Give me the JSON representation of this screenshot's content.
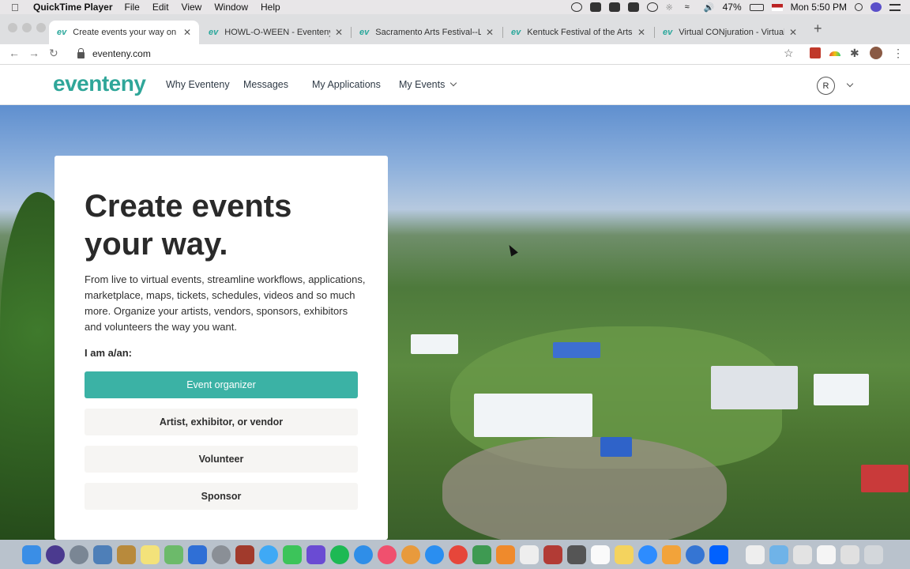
{
  "menubar": {
    "app_name": "QuickTime Player",
    "menus": [
      "File",
      "Edit",
      "View",
      "Window",
      "Help"
    ],
    "battery": "47%",
    "clock": "Mon 5:50 PM"
  },
  "browser": {
    "tabs": [
      {
        "title": "Create events your way on Eve",
        "favicon": "ev"
      },
      {
        "title": "HOWL-O-WEEN - Eventeny",
        "favicon": "ev"
      },
      {
        "title": "Sacramento Arts Festival--Live",
        "favicon": "ev"
      },
      {
        "title": "Kentuck Festival of the Arts Vi",
        "favicon": "ev"
      },
      {
        "title": "Virtual CONjuration - Virtual C",
        "favicon": "ev"
      }
    ],
    "url": "eventeny.com"
  },
  "site": {
    "logo": "eventeny",
    "nav": [
      "Why Eventeny",
      "Messages",
      "My Applications",
      "My Events"
    ],
    "avatar_initial": "R",
    "accent_color": "#3bb2a5"
  },
  "hero": {
    "headline": "Create events your way.",
    "description": "From live to virtual events, streamline workflows, applications, marketplace, maps, tickets, schedules, videos and so much more. Organize your artists, vendors, sponsors, exhibitors and volunteers the way you want.",
    "role_prompt": "I am a/an:",
    "buttons": [
      "Event organizer",
      "Artist, exhibitor, or vendor",
      "Volunteer",
      "Sponsor"
    ]
  }
}
